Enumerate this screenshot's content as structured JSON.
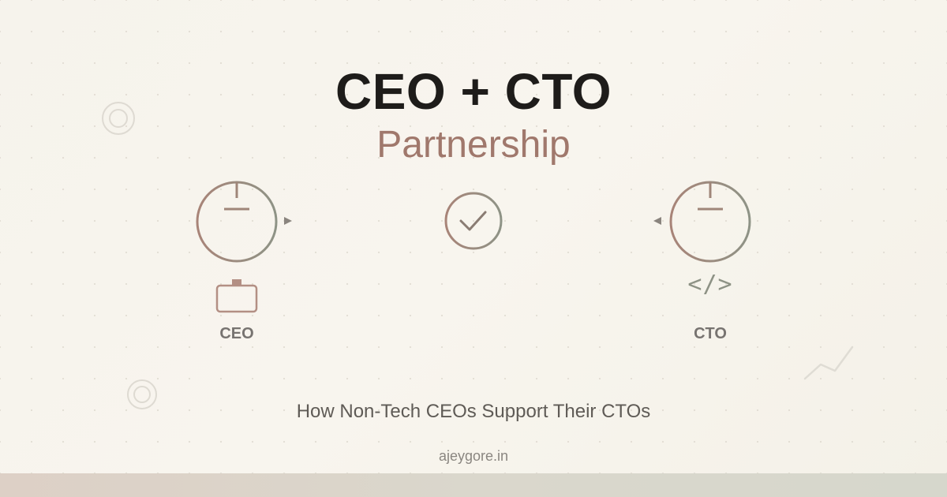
{
  "header": {
    "title": "CEO + CTO",
    "subtitle": "Partnership"
  },
  "ceo": {
    "label": "CEO",
    "icon": "briefcase-icon"
  },
  "cto": {
    "label": "CTO",
    "icon": "code-icon",
    "code_glyph": "</>"
  },
  "center": {
    "icon": "checkmark-icon"
  },
  "tagline": "How Non-Tech CEOs Support Their CTOs",
  "site": "ajeygore.in",
  "colors": {
    "title": "#1e1c1a",
    "accent": "#a0786c",
    "secondary": "#8d9285",
    "background": "#f6f3ec"
  }
}
